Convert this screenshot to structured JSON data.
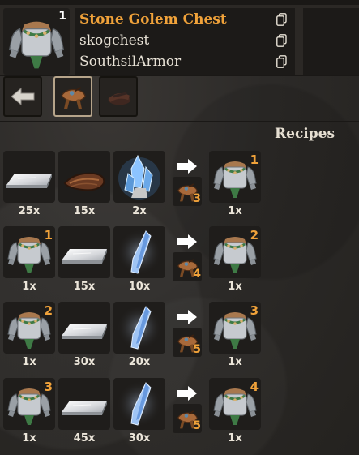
{
  "item": {
    "count": "1",
    "title": "Stone Golem Chest",
    "prefab": "skogchest",
    "mod_name": "SouthsilArmor",
    "icon": "stone-golem-chest-icon"
  },
  "nav": {
    "back_icon": "arrow-left-icon",
    "tab1_icon": "workbench-icon",
    "tab2_icon": "forge-icon"
  },
  "recipes_title": "Recipes",
  "recipes": [
    {
      "ingredients": [
        {
          "icon": "iron-ingot-icon",
          "amount": "25x",
          "level": ""
        },
        {
          "icon": "leather-scraps-icon",
          "amount": "15x",
          "level": ""
        },
        {
          "icon": "crystal-icon",
          "amount": "2x",
          "level": ""
        }
      ],
      "station_level": "3",
      "result": {
        "icon": "stone-golem-chest-icon",
        "amount": "1x",
        "level": "1"
      }
    },
    {
      "ingredients": [
        {
          "icon": "stone-golem-chest-icon",
          "amount": "1x",
          "level": "1"
        },
        {
          "icon": "silver-ingot-icon",
          "amount": "15x",
          "level": ""
        },
        {
          "icon": "blue-crystal-shard-icon",
          "amount": "10x",
          "level": ""
        }
      ],
      "station_level": "4",
      "result": {
        "icon": "stone-golem-chest-icon",
        "amount": "1x",
        "level": "2"
      }
    },
    {
      "ingredients": [
        {
          "icon": "stone-golem-chest-icon",
          "amount": "1x",
          "level": "2"
        },
        {
          "icon": "silver-ingot-icon",
          "amount": "30x",
          "level": ""
        },
        {
          "icon": "blue-crystal-shard-icon",
          "amount": "20x",
          "level": ""
        }
      ],
      "station_level": "5",
      "result": {
        "icon": "stone-golem-chest-icon",
        "amount": "1x",
        "level": "3"
      }
    },
    {
      "ingredients": [
        {
          "icon": "stone-golem-chest-icon",
          "amount": "1x",
          "level": "3"
        },
        {
          "icon": "silver-ingot-icon",
          "amount": "45x",
          "level": ""
        },
        {
          "icon": "blue-crystal-shard-icon",
          "amount": "30x",
          "level": ""
        }
      ],
      "station_level": "5",
      "result": {
        "icon": "stone-golem-chest-icon",
        "amount": "1x",
        "level": "4"
      }
    }
  ],
  "colors": {
    "title": "#f0a23a",
    "level": "#f0a23a",
    "text": "#ece6da"
  }
}
